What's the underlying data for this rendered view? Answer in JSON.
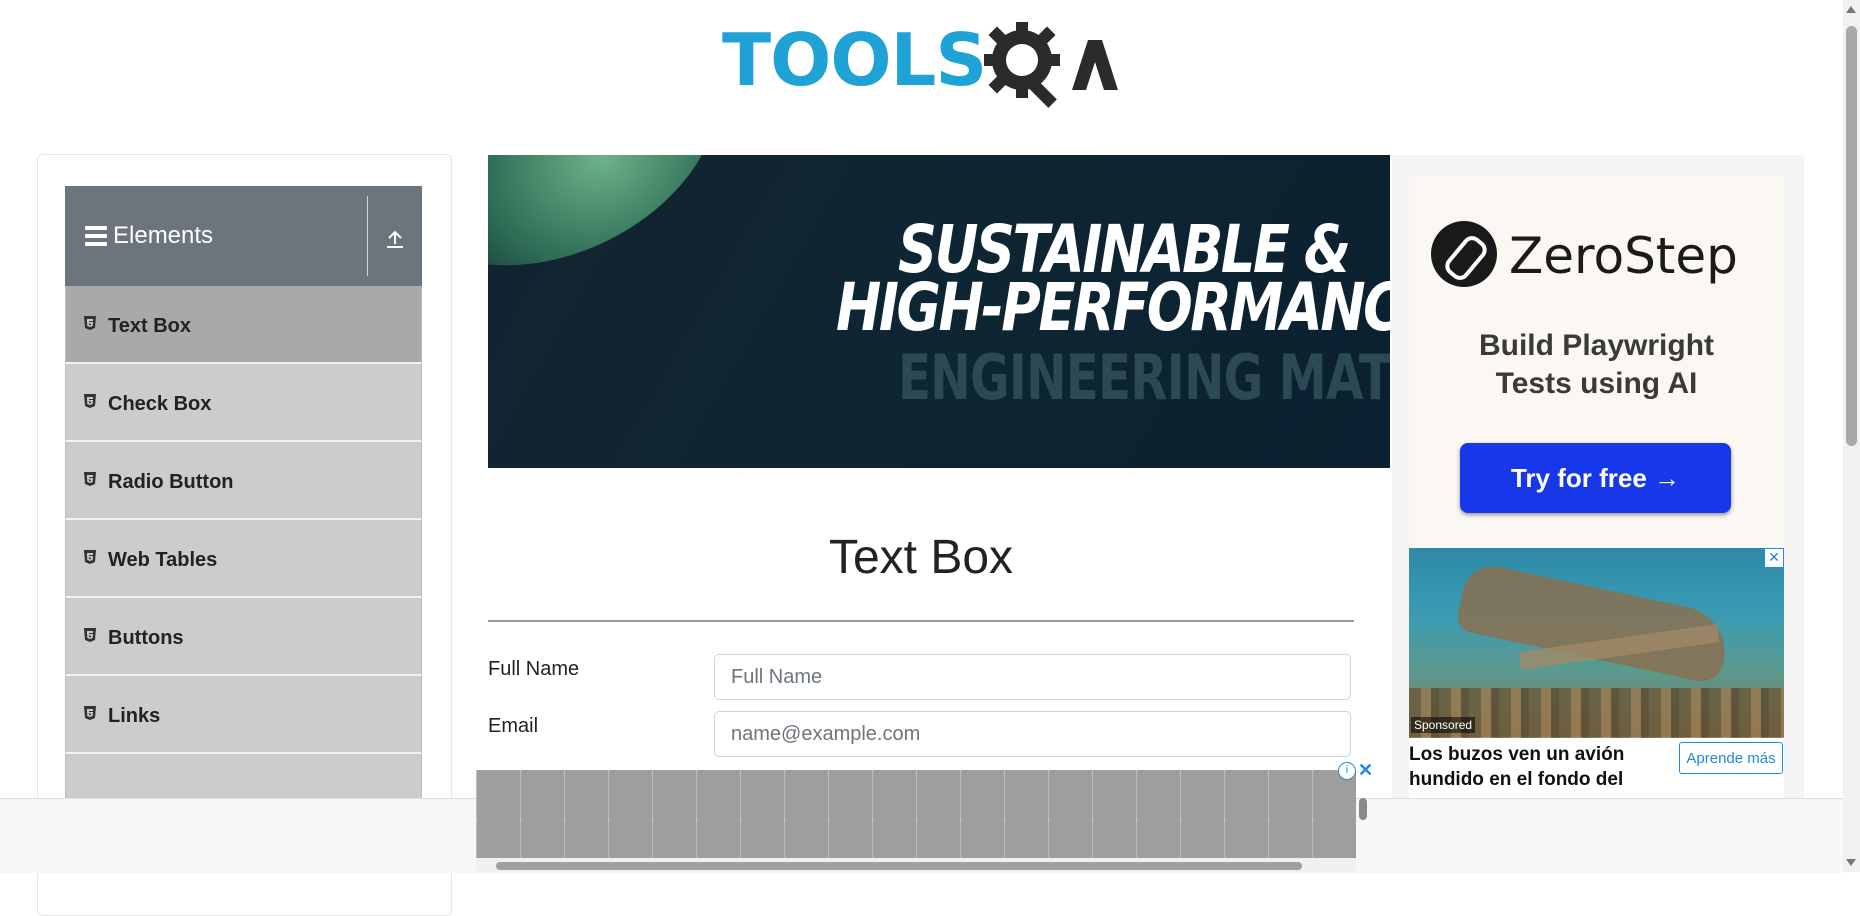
{
  "header": {
    "logo_text": "TOOLS",
    "logo_qa": "QA"
  },
  "sidebar": {
    "group_title": "Elements",
    "items": [
      {
        "label": "Text Box",
        "active": true
      },
      {
        "label": "Check Box"
      },
      {
        "label": "Radio Button"
      },
      {
        "label": "Web Tables"
      },
      {
        "label": "Buttons"
      },
      {
        "label": "Links"
      },
      {
        "label": ""
      }
    ]
  },
  "banner": {
    "line1": "SUSTAINABLE &",
    "line2": "HIGH-PERFORMANCE",
    "line3": "ENGINEERING MATERIA"
  },
  "main": {
    "title": "Text Box",
    "fields": [
      {
        "label": "Full Name",
        "placeholder": "Full Name",
        "value": ""
      },
      {
        "label": "Email",
        "placeholder": "name@example.com",
        "value": ""
      }
    ]
  },
  "right_ad": {
    "brand": "ZeroStep",
    "headline_line1": "Build Playwright",
    "headline_line2": "Tests using AI",
    "cta": "Try for free →"
  },
  "sponsored_ad": {
    "badge": "Sponsored",
    "text": "Los buzos ven un avión hundido en el fondo del",
    "button": "Aprende más",
    "close": "✕"
  },
  "bottom_ad": {
    "info": "i",
    "close": "✕"
  },
  "colors": {
    "sidebar_header": "#6c757d",
    "menu_item": "#cccccc",
    "menu_active": "#a9a9a9",
    "cta": "#1738e8",
    "logo_blue": "#1fa3d6"
  }
}
